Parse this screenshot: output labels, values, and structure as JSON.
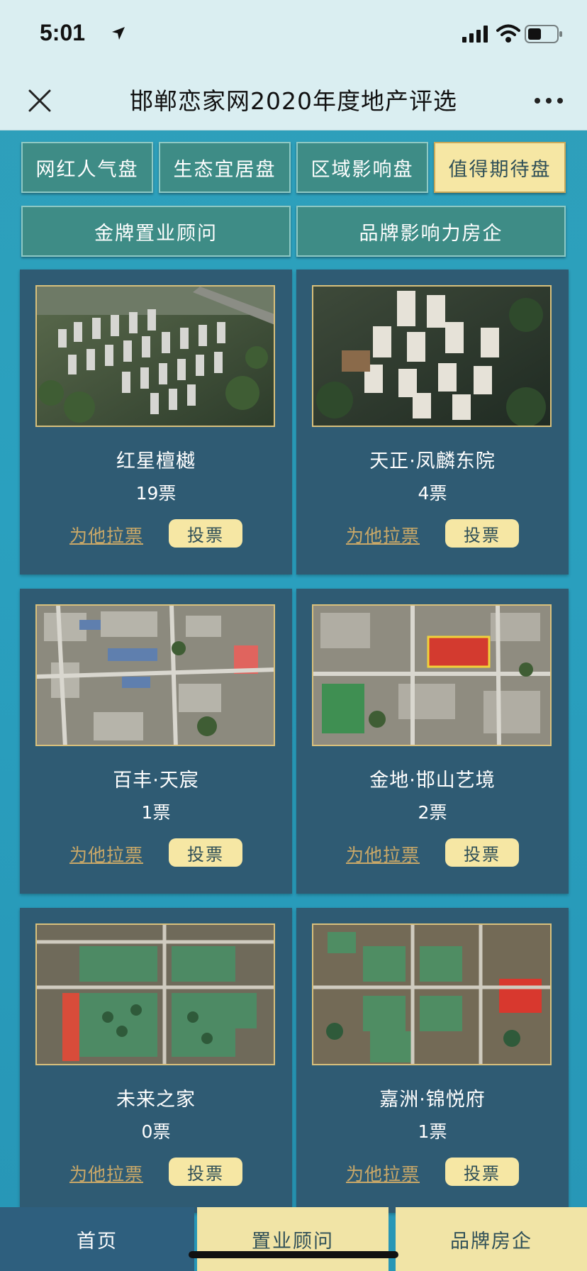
{
  "status": {
    "time": "5:01"
  },
  "nav": {
    "title": "邯郸恋家网2020年度地产评选"
  },
  "tabs_row1": [
    {
      "label": "网红人气盘",
      "active": false
    },
    {
      "label": "生态宜居盘",
      "active": false
    },
    {
      "label": "区域影响盘",
      "active": false
    },
    {
      "label": "值得期待盘",
      "active": true
    }
  ],
  "tabs_row2": [
    {
      "label": "金牌置业顾问"
    },
    {
      "label": "品牌影响力房企"
    }
  ],
  "cards": [
    {
      "name": "红星檀樾",
      "votes": "19票",
      "canvass": "为他拉票",
      "vote": "投票"
    },
    {
      "name": "天正·凤麟东院",
      "votes": "4票",
      "canvass": "为他拉票",
      "vote": "投票"
    },
    {
      "name": "百丰·天宸",
      "votes": "1票",
      "canvass": "为他拉票",
      "vote": "投票"
    },
    {
      "name": "金地·邯山艺境",
      "votes": "2票",
      "canvass": "为他拉票",
      "vote": "投票"
    },
    {
      "name": "未来之家",
      "votes": "0票",
      "canvass": "为他拉票",
      "vote": "投票"
    },
    {
      "name": "嘉洲·锦悦府",
      "votes": "1票",
      "canvass": "为他拉票",
      "vote": "投票"
    }
  ],
  "bottom_nav": {
    "home": "首页",
    "advisor": "置业顾问",
    "brand": "品牌房企"
  },
  "colors": {
    "tab_bg": "#3e8c86",
    "tab_active_bg": "#f6e7a4",
    "card_bg": "#2f5b73",
    "vote_button": "#f6e7a4",
    "canvass_link": "#c9a868",
    "page_bg": "#2aa0bf"
  },
  "icons": {
    "status_arrow": "location-arrow-icon",
    "signal": "cellular-signal-icon",
    "wifi": "wifi-icon",
    "battery": "battery-icon",
    "close": "close-icon",
    "more": "more-dots-icon"
  }
}
